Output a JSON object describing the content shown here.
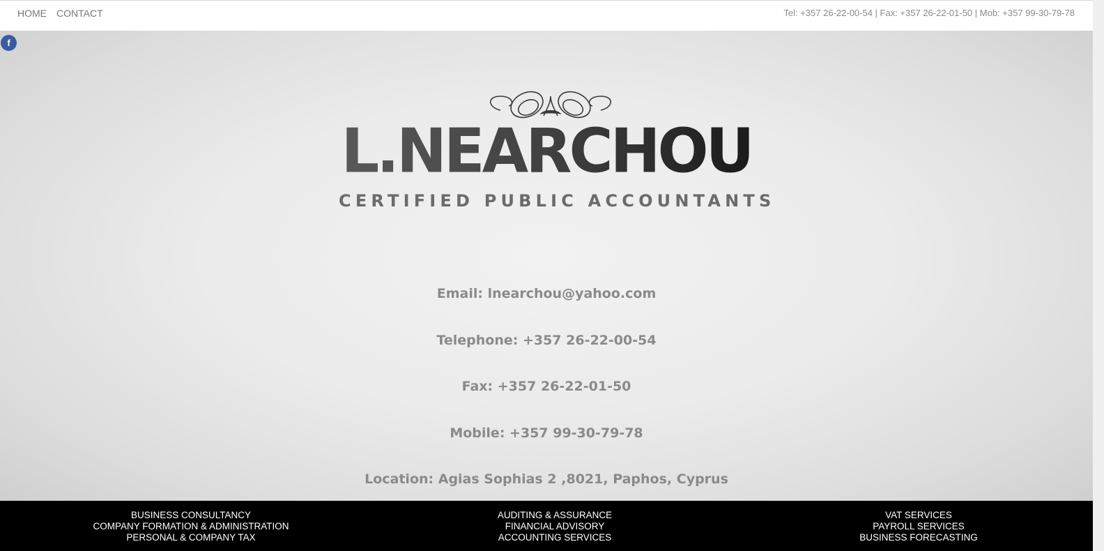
{
  "nav": {
    "home": "HOME",
    "contact": "CONTACT"
  },
  "top_contact": "Tel: +357 26-22-00-54 | Fax: +357 26-22-01-50 | Mob: +357 99-30-79-78",
  "social": {
    "facebook_glyph": "f",
    "facebook_icon": "facebook-icon",
    "facebook_color": "#3b5ba0"
  },
  "logo": {
    "name": "L.NEARCHOU",
    "tagline": "CERTIFIED PUBLIC ACCOUNTANTS"
  },
  "contact_info": [
    "Email: lnearchou@yahoo.com",
    "Telephone: +357 26-22-00-54",
    "Fax: +357 26-22-01-50",
    "Mobile: +357 99-30-79-78",
    "Location: Agias Sophias 2 ,8021, Paphos, Cyprus"
  ],
  "footer": {
    "col1": [
      "BUSINESS CONSULTANCY",
      "COMPANY FORMATION & ADMINISTRATION",
      "PERSONAL & COMPANY TAX"
    ],
    "col2": [
      "AUDITING & ASSURANCE",
      "FINANCIAL ADVISORY",
      "ACCOUNTING SERVICES"
    ],
    "col3": [
      "VAT SERVICES",
      "PAYROLL SERVICES",
      "BUSINESS FORECASTING"
    ]
  }
}
